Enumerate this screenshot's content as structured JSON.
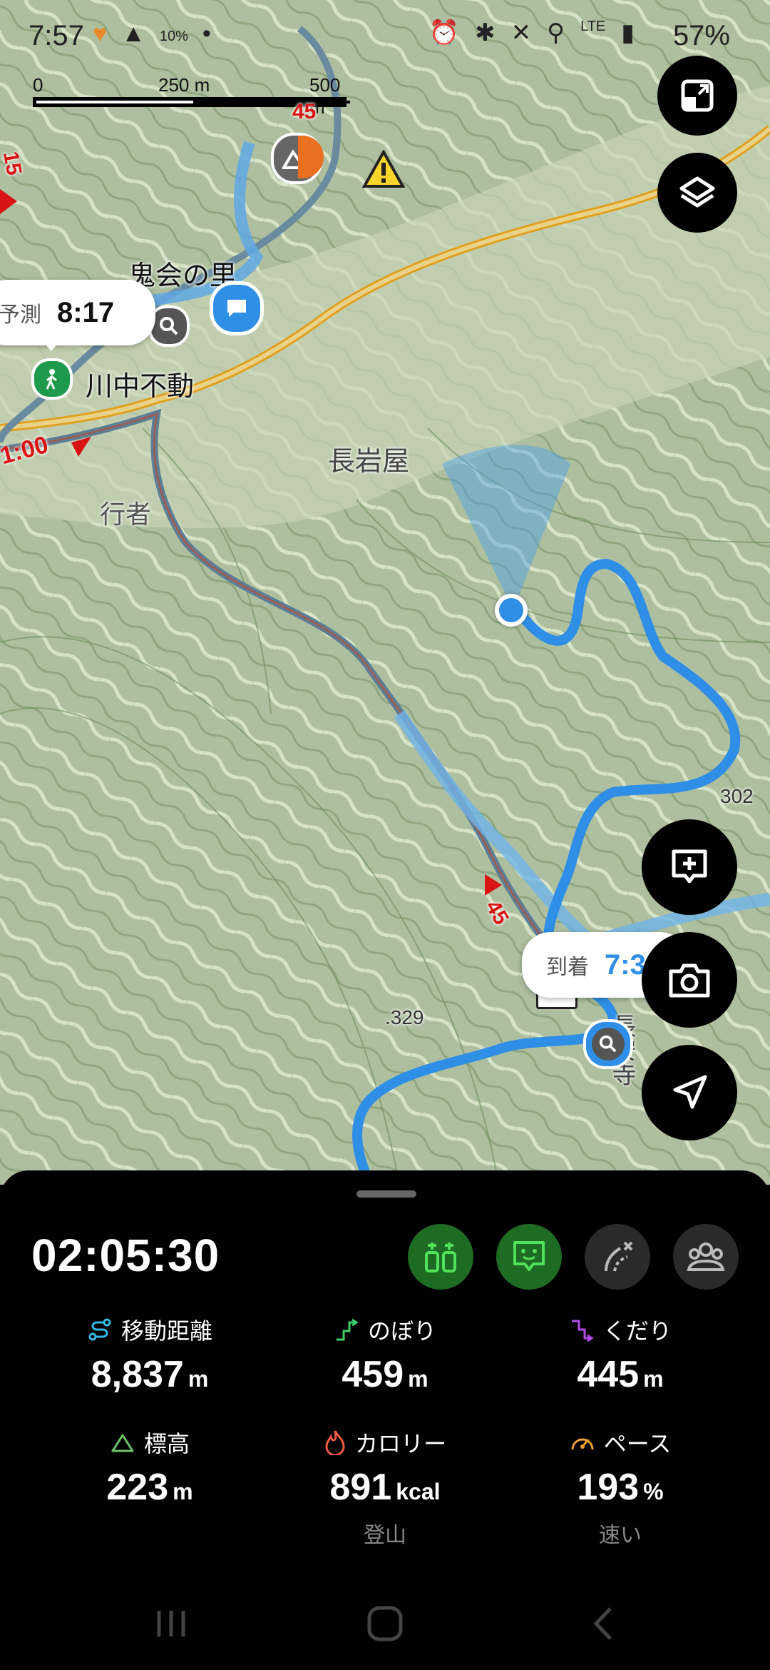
{
  "status_bar": {
    "time": "7:57",
    "battery": "57%",
    "signal_label": "LTE",
    "small_badge": "10%"
  },
  "scale_bar": {
    "labels": [
      "0",
      "250 m",
      "500 m"
    ]
  },
  "map_labels": {
    "place_1": "鬼会の里",
    "place_2": "川中不動",
    "place_3": "長岩屋",
    "place_4": "行者",
    "temple": "長安寺",
    "elev_1": "302",
    "elev_2": ".329",
    "route_time_1": "1:00",
    "route_num_1": "45",
    "route_num_2": "45",
    "route_num_3": "15"
  },
  "bubbles": {
    "forecast": {
      "label": "予測",
      "time": "8:17"
    },
    "arrival": {
      "label": "到着",
      "time": "7:3"
    }
  },
  "panel": {
    "timer": "02:05:30",
    "stats": [
      {
        "label": "移動距離",
        "value": "8,837",
        "unit": "m",
        "icon": "distance-icon",
        "color": "#35b8e6"
      },
      {
        "label": "のぼり",
        "value": "459",
        "unit": "m",
        "icon": "ascent-icon",
        "color": "#3ccf68"
      },
      {
        "label": "くだり",
        "value": "445",
        "unit": "m",
        "icon": "descent-icon",
        "color": "#b44de8"
      },
      {
        "label": "標高",
        "value": "223",
        "unit": "m",
        "icon": "mountain-icon",
        "color": "#6cc46a"
      },
      {
        "label": "カロリー",
        "value": "891",
        "unit": "kcal",
        "icon": "flame-icon",
        "color": "#ef5a44",
        "sub": "登山"
      },
      {
        "label": "ペース",
        "value": "193",
        "unit": "%",
        "icon": "speedometer-icon",
        "color": "#f0a030",
        "sub": "速い"
      }
    ]
  },
  "colors": {
    "route": "#2f8fe6",
    "accent_green": "#1e6b23",
    "icon_green": "#53e05a"
  }
}
